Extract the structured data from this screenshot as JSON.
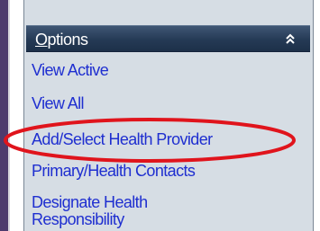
{
  "panel": {
    "header": {
      "title_accel": "O",
      "title_rest": "ptions",
      "collapse_icon": "double-chevron-up-icon"
    },
    "items": [
      {
        "label": "View Active"
      },
      {
        "label": "View All"
      },
      {
        "label": "Add/Select Health Provider"
      },
      {
        "label": "Primary/Health Contacts"
      },
      {
        "label": "Designate Health Responsibility"
      }
    ]
  },
  "annotation": {
    "highlighted_item": "Add/Select Health Provider",
    "color": "#e0141c"
  },
  "colors": {
    "header_bg": "#253a55",
    "panel_bg": "#d6dde4",
    "link": "#1f2fd0",
    "left_strip": "#4e3a6d"
  }
}
